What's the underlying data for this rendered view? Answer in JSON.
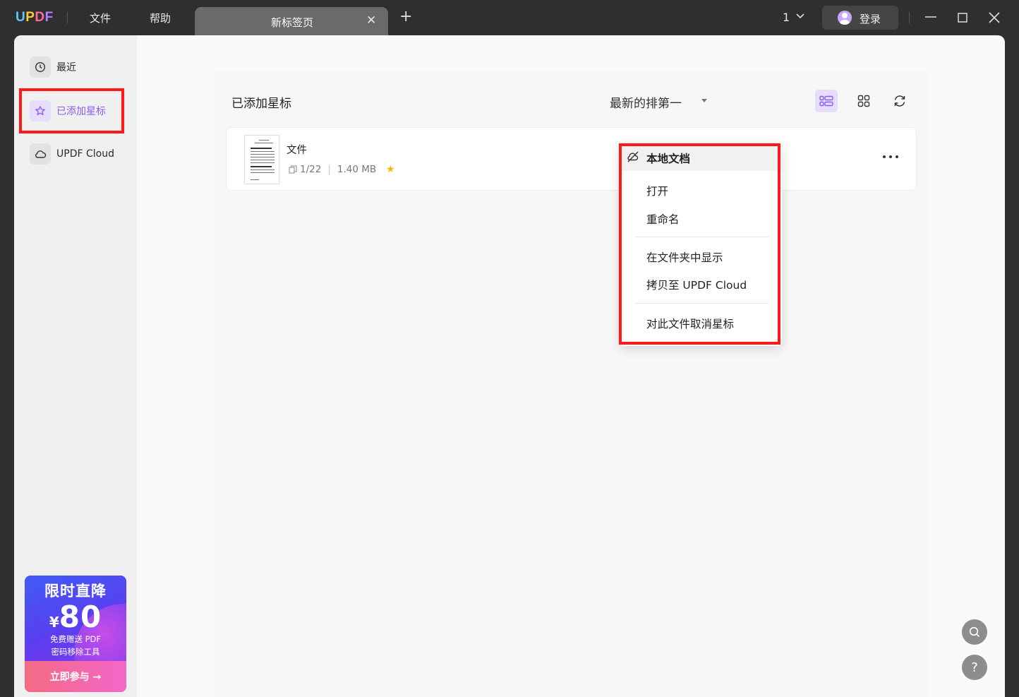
{
  "titlebar": {
    "logo": {
      "u": "U",
      "p": "P",
      "d": "D",
      "f": "F"
    },
    "menu_file": "文件",
    "menu_help": "帮助",
    "tab_label": "新标签页",
    "window_count": "1",
    "login_label": "登录"
  },
  "sidebar": {
    "items": [
      {
        "label": "最近",
        "icon": "clock-icon"
      },
      {
        "label": "已添加星标",
        "icon": "star-icon"
      },
      {
        "label": "UPDF Cloud",
        "icon": "cloud-icon"
      }
    ],
    "active_index": 1
  },
  "promo": {
    "title": "限时直降",
    "currency": "¥",
    "amount": "80",
    "line1": "免费赠送 PDF",
    "line2": "密码移除工具",
    "cta": "立即参与 →"
  },
  "main": {
    "section_title": "已添加星标",
    "sort_label": "最新的排第一",
    "view_mode": "list"
  },
  "files": [
    {
      "name": "文件",
      "pages": "1/22",
      "size": "1.40 MB",
      "starred": true
    }
  ],
  "context_menu": {
    "header": "本地文档",
    "items": [
      "打开",
      "重命名",
      "在文件夹中显示",
      "拷贝至 UPDF Cloud",
      "对此文件取消星标"
    ]
  },
  "colors": {
    "accent": "#8b5cf6",
    "highlight": "#ff1a1a",
    "star": "#f5b800"
  }
}
